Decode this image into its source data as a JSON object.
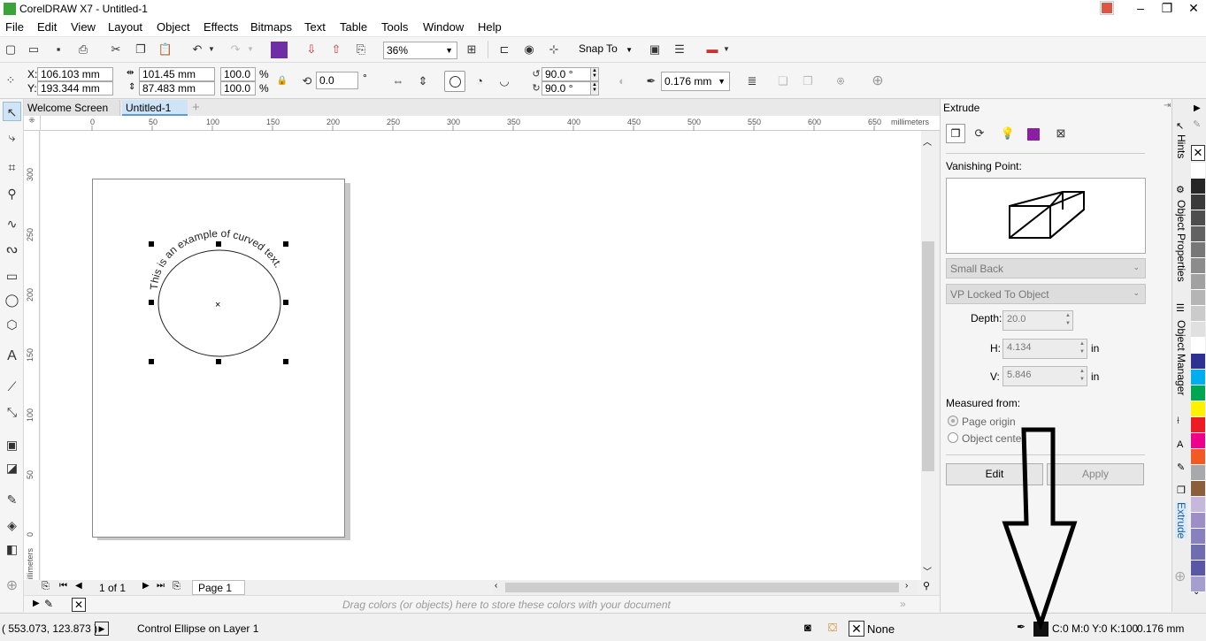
{
  "window": {
    "title": "CorelDRAW X7 - Untitled-1"
  },
  "menu": [
    "File",
    "Edit",
    "View",
    "Layout",
    "Object",
    "Effects",
    "Bitmaps",
    "Text",
    "Table",
    "Tools",
    "Window",
    "Help"
  ],
  "standard_toolbar": {
    "zoom": "36%",
    "snap_to": "Snap To"
  },
  "property_bar": {
    "x": "106.103 mm",
    "y": "193.344 mm",
    "width": "101.45 mm",
    "height": "87.483 mm",
    "scale_w": "100.0",
    "scale_h": "100.0",
    "percent": "%",
    "rotation": "0.0",
    "degree": "°",
    "angle_start": "90.0 °",
    "angle_end": "90.0 °",
    "outline_width": "0.176 mm"
  },
  "tabs": {
    "welcome": "Welcome Screen",
    "doc": "Untitled-1",
    "add": "+"
  },
  "rulers": {
    "h_ticks": [
      "0",
      "50",
      "100",
      "150",
      "200",
      "250",
      "300",
      "350",
      "400",
      "450",
      "500",
      "550",
      "600",
      "650"
    ],
    "h_unit": "millimeters",
    "v_ticks": [
      "300",
      "250",
      "200",
      "150",
      "100",
      "50",
      "0"
    ],
    "v_unit": "millimeters"
  },
  "canvas": {
    "curved_text": "This is an example of curved text."
  },
  "page_nav": {
    "count": "1 of 1",
    "page_tab": "Page 1"
  },
  "color_well": {
    "hint": "Drag colors (or objects) here to store these colors with your document"
  },
  "docker": {
    "title": "Extrude",
    "vanishing_point_label": "Vanishing Point:",
    "extrusion_type": "Small Back",
    "vp_mode": "VP Locked To Object",
    "depth_label": "Depth:",
    "depth": "20.0",
    "h_label": "H:",
    "h_value": "4.134",
    "h_unit": "in",
    "v_label": "V:",
    "v_value": "5.846",
    "v_unit": "in",
    "measured_from": "Measured from:",
    "page_origin": "Page origin",
    "object_center": "Object cente",
    "edit": "Edit",
    "apply": "Apply"
  },
  "side_tabs": {
    "hints": "Hints",
    "object_properties": "Object Properties",
    "object_manager": "Object Manager",
    "extrude": "Extrude"
  },
  "palette_colors": [
    "#ffffff",
    "#262626",
    "#3a3a3a",
    "#4d4d4d",
    "#626262",
    "#777777",
    "#8c8c8c",
    "#a1a1a1",
    "#b5b5b5",
    "#cbcbcb",
    "#e0e0e0",
    "#ffffff",
    "#2e3192",
    "#00aeef",
    "#00a651",
    "#fff200",
    "#ed1c24",
    "#ec008c",
    "#f15a24",
    "#a7a9ac",
    "#8b5e3c",
    "#c6b8dc",
    "#9d8ec5",
    "#8781bd",
    "#6f6db0",
    "#5b57a4",
    "#a59fcf"
  ],
  "status": {
    "coords": "( 553.073, 123.873 )",
    "info": "Control Ellipse on Layer 1",
    "fill": "None",
    "color": "C:0 M:0 Y:0 K:100",
    "outline": "0.176 mm"
  },
  "colors": {
    "selected_tab": "#cfe4f7",
    "accent": "#6f2da8"
  }
}
